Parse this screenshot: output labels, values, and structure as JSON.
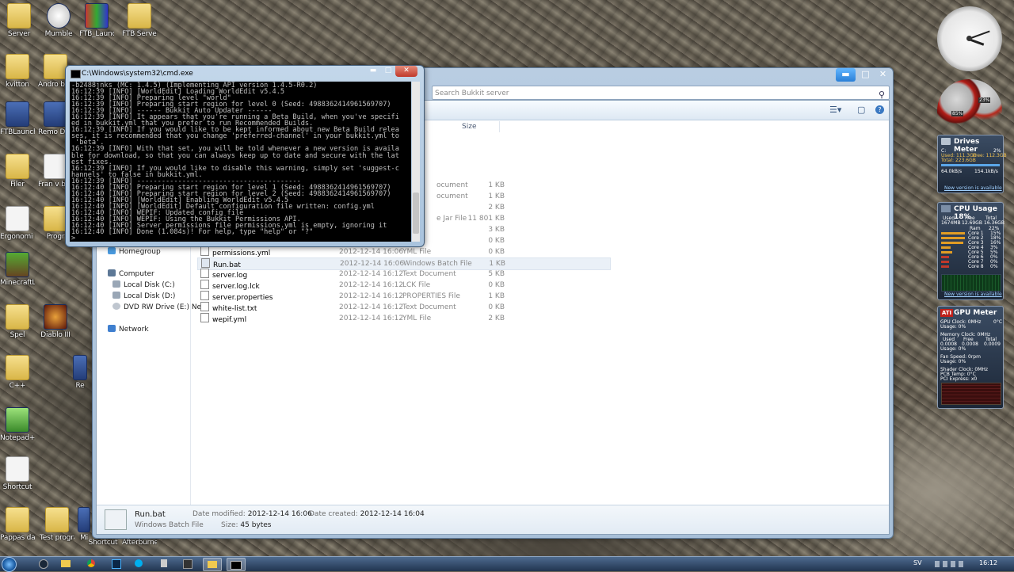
{
  "desktop": {
    "icons": [
      {
        "label": "Server",
        "kind": "folder"
      },
      {
        "label": "Mumble",
        "kind": "app"
      },
      {
        "label": "FTB_Launc...",
        "kind": "app"
      },
      {
        "label": "FTB Server",
        "kind": "folder"
      },
      {
        "label": "kvitton",
        "kind": "folder"
      },
      {
        "label": "Andro backu",
        "kind": "folder"
      },
      {
        "label": "FTBLaunch...",
        "kind": "app"
      },
      {
        "label": "Remo Deskto",
        "kind": "app"
      },
      {
        "label": "Filer",
        "kind": "folder"
      },
      {
        "label": "Fran v bensin",
        "kind": "doc"
      },
      {
        "label": "Ergonomi uppsats.rtf",
        "kind": "doc"
      },
      {
        "label": "Progr",
        "kind": "folder"
      },
      {
        "label": "MinecraftL...",
        "kind": "app"
      },
      {
        "label": "Spel",
        "kind": "folder"
      },
      {
        "label": "Diablo III",
        "kind": "app"
      },
      {
        "label": "C++",
        "kind": "folder"
      },
      {
        "label": "Re",
        "kind": "app"
      },
      {
        "label": "Notepad++",
        "kind": "app"
      },
      {
        "label": "Shortcut",
        "kind": "app"
      },
      {
        "label": "Pappas datafiler",
        "kind": "folder"
      },
      {
        "label": "Test program",
        "kind": "folder"
      },
      {
        "label": "Mi",
        "kind": "app"
      },
      {
        "label": "Shortcut",
        "kind": "app"
      },
      {
        "label": "Afterburner",
        "kind": "app"
      }
    ]
  },
  "cmd": {
    "title": "C:\\Windows\\system32\\cmd.exe",
    "console_text": "-b2488jnks (MC: 1.4.5) (Implementing API version 1.4.5-R0.2)\n16:12:39 [INFO] [WorldEdit] Loading WorldEdit v5.4.5\n16:12:39 [INFO] Preparing level \"world\"\n16:12:39 [INFO] Preparing start region for level 0 (Seed: 4988362414961569707)\n16:12:39 [INFO] ------ Bukkit Auto Updater ------\n16:12:39 [INFO] It appears that you're running a Beta Build, when you've specifi\ned in bukkit.yml that you prefer to run Recommended Builds.\n16:12:39 [INFO] If you would like to be kept informed about new Beta Build relea\nses, it is recommended that you change 'preferred-channel' in your bukkit.yml to\n 'beta'.\n16:12:39 [INFO] With that set, you will be told whenever a new version is availa\nble for download, so that you can always keep up to date and secure with the lat\nest fixes.\n16:12:39 [INFO] If you would like to disable this warning, simply set 'suggest-c\nhannels' to false in bukkit.yml.\n16:12:39 [INFO] ----------------------------------------\n16:12:40 [INFO] Preparing start region for level 1 (Seed: 4988362414961569707)\n16:12:40 [INFO] Preparing start region for level 2 (Seed: 4988362414961569707)\n16:12:40 [INFO] [WorldEdit] Enabling WorldEdit v5.4.5\n16:12:40 [INFO] [WorldEdit] Default configuration file written: config.yml\n16:12:40 [INFO] WEPIF: Updated config file\n16:12:40 [INFO] WEPIF: Using the Bukkit Permissions API.\n16:12:40 [INFO] Server permissions file permissions.yml is empty, ignoring it\n16:12:40 [INFO] Done (1.084s)! For help, type \"help\" or \"?\"\n>"
  },
  "explorer": {
    "search_placeholder": "Search Bukkit server",
    "columns": {
      "size": "Size"
    },
    "nav": {
      "homegroup": "Homegroup",
      "computer": "Computer",
      "local_c": "Local Disk (C:)",
      "local_d": "Local Disk (D:)",
      "dvd": "DVD RW Drive (E:) New",
      "network": "Network"
    },
    "partial_rows": [
      {
        "type": "ocument",
        "size": "1 KB"
      },
      {
        "type": "ocument",
        "size": "1 KB"
      },
      {
        "type": "",
        "size": "2 KB"
      },
      {
        "type": "e Jar File",
        "size": "11 801 KB"
      },
      {
        "type": "",
        "size": "3 KB"
      },
      {
        "type": "",
        "size": "0 KB"
      },
      {
        "type": "ocument",
        "size": "0 KB"
      }
    ],
    "files": [
      {
        "name": "permissions.yml",
        "date": "2012-12-14 16:06",
        "type": "YML File",
        "size": "0 KB"
      },
      {
        "name": "Run.bat",
        "date": "2012-12-14 16:06",
        "type": "Windows Batch File",
        "size": "1 KB"
      },
      {
        "name": "server.log",
        "date": "2012-12-14 16:12",
        "type": "Text Document",
        "size": "5 KB"
      },
      {
        "name": "server.log.lck",
        "date": "2012-12-14 16:12",
        "type": "LCK File",
        "size": "0 KB"
      },
      {
        "name": "server.properties",
        "date": "2012-12-14 16:12",
        "type": "PROPERTIES File",
        "size": "1 KB"
      },
      {
        "name": "white-list.txt",
        "date": "2012-12-14 16:12",
        "type": "Text Document",
        "size": "0 KB"
      },
      {
        "name": "wepif.yml",
        "date": "2012-12-14 16:12",
        "type": "YML File",
        "size": "2 KB"
      }
    ],
    "details": {
      "name": "Run.bat",
      "type": "Windows Batch File",
      "modified_label": "Date modified:",
      "modified_value": "2012-12-14 16:06",
      "size_label": "Size:",
      "size_value": "45 bytes",
      "created_label": "Date created:",
      "created_value": "2012-12-14 16:04"
    }
  },
  "gadgets": {
    "drives": {
      "title": "Drives Meter",
      "line1": "C:",
      "line1b": "2%",
      "used": "Used: 111.3GB",
      "free": "Free: 112.3GB",
      "total": "Total: 223.6GB",
      "speed1": "64.0kB/s",
      "speed2": "154.1kB/s",
      "link": "New version is available"
    },
    "cpu": {
      "title": "CPU Usage",
      "value": "18%",
      "h1": "Used",
      "h2": "Free",
      "h3": "Total",
      "v1": "1674MB",
      "v2": "12.69GB",
      "v3": "16.36GB",
      "ram_label": "Ram",
      "ram_val": "22%",
      "cores": [
        {
          "label": "Core 1",
          "val": "15%"
        },
        {
          "label": "Core 2",
          "val": "18%"
        },
        {
          "label": "Core 3",
          "val": "16%"
        },
        {
          "label": "Core 4",
          "val": "3%"
        },
        {
          "label": "Core 5",
          "val": "5%"
        },
        {
          "label": "Core 6",
          "val": "0%"
        },
        {
          "label": "Core 7",
          "val": "0%"
        },
        {
          "label": "Core 8",
          "val": "0%"
        }
      ],
      "link": "New version is available"
    },
    "gpu": {
      "title": "GPU Meter",
      "brand": "ATI",
      "gpu_clock": "GPU Clock: 0MHz",
      "gpu_temp": "0°C",
      "usage1": "Usage: 0%",
      "mem_clock": "Memory Clock: 0MHz",
      "mh1": "Used",
      "mh2": "Free",
      "mh3": "Total",
      "mv1": "0.0008",
      "mv2": "0.0008",
      "mv3": "0.0009",
      "usage2": "Usage: 0%",
      "fan": "Fan Speed: 0rpm",
      "usage3": "Usage: 0%",
      "shader": "Shader Clock: 0MHz",
      "pcb": "PCB Temp: 0°C",
      "pci": "PCI Express: x0"
    },
    "meter": {
      "left": "85%",
      "right": "23%"
    }
  },
  "taskbar": {
    "lang": "SV",
    "time": "16:12"
  }
}
